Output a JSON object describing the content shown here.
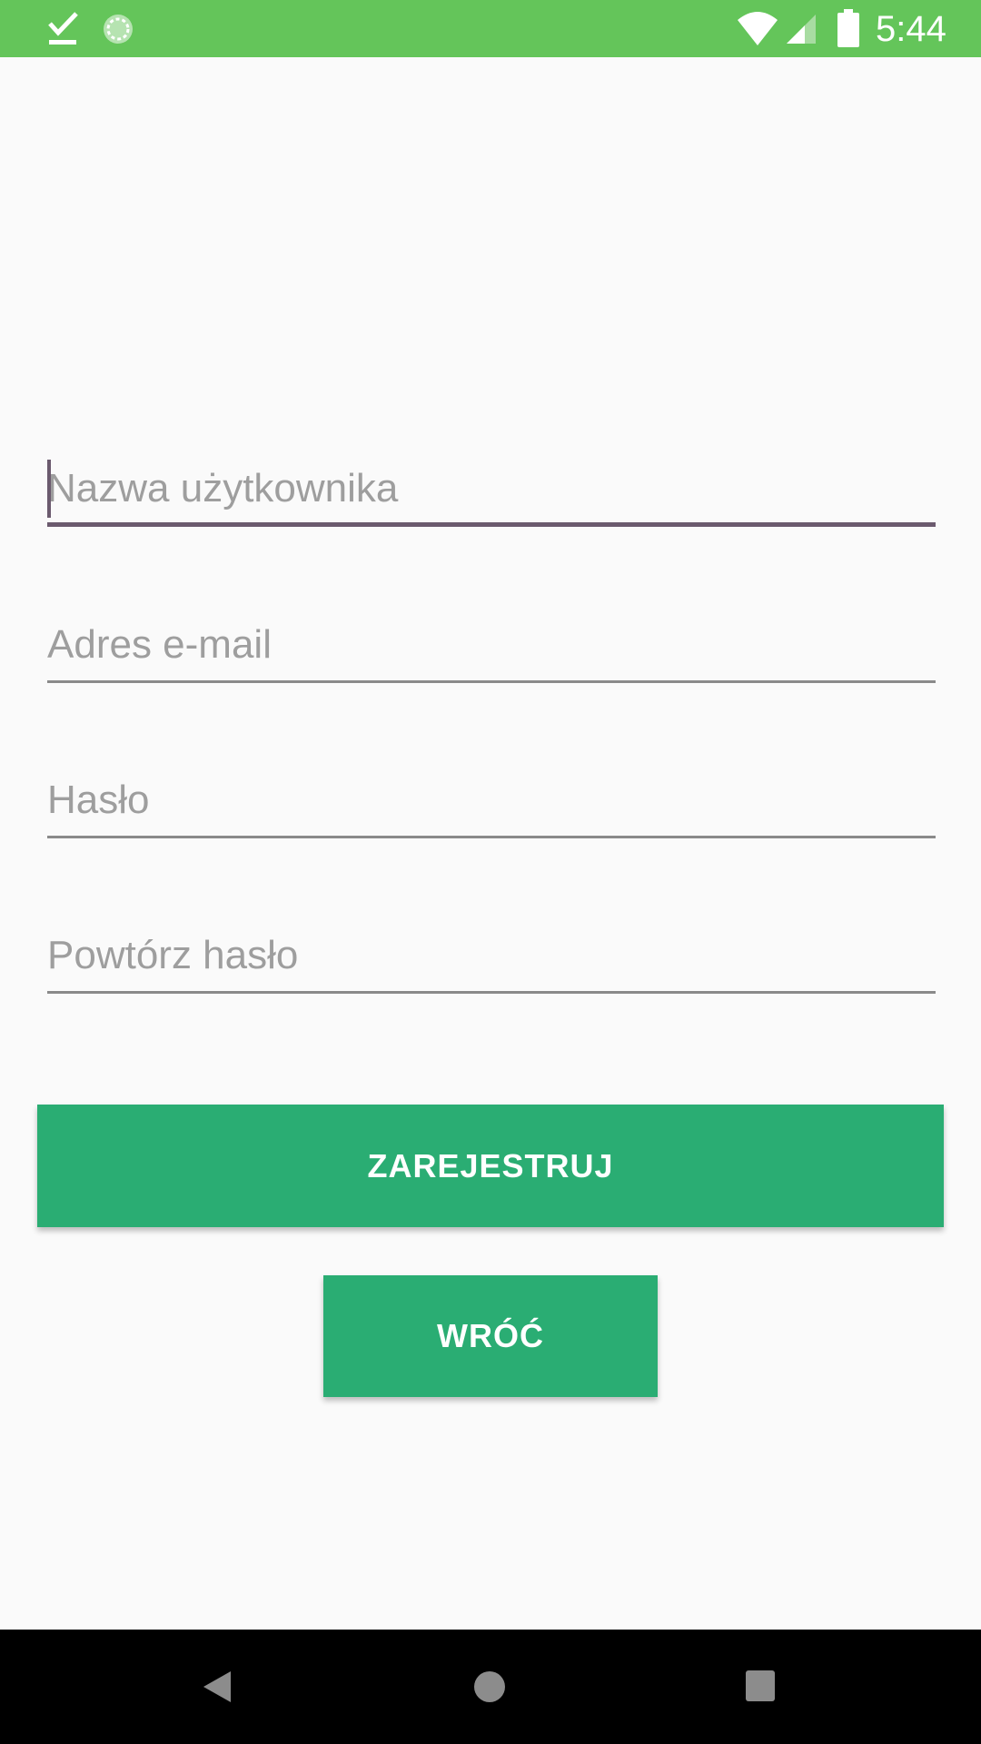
{
  "status_bar": {
    "time": "5:44",
    "background_color": "#64c55a",
    "icons": [
      "download-done-icon",
      "sync-circle-icon",
      "wifi-icon",
      "cellular-signal-icon",
      "battery-icon"
    ]
  },
  "form": {
    "username": {
      "placeholder": "Nazwa użytkownika",
      "value": ""
    },
    "email": {
      "placeholder": "Adres e-mail",
      "value": ""
    },
    "password": {
      "placeholder": "Hasło",
      "value": ""
    },
    "repeat_password": {
      "placeholder": "Powtórz hasło",
      "value": ""
    }
  },
  "buttons": {
    "register_label": "ZAREJESTRUJ",
    "back_label": "WRÓĆ",
    "color": "#2aad73"
  },
  "nav_bar": {
    "icons": [
      "back-icon",
      "home-icon",
      "recent-apps-icon"
    ]
  },
  "colors": {
    "focus_accent": "#6b5a6e",
    "background": "#fafafa"
  }
}
